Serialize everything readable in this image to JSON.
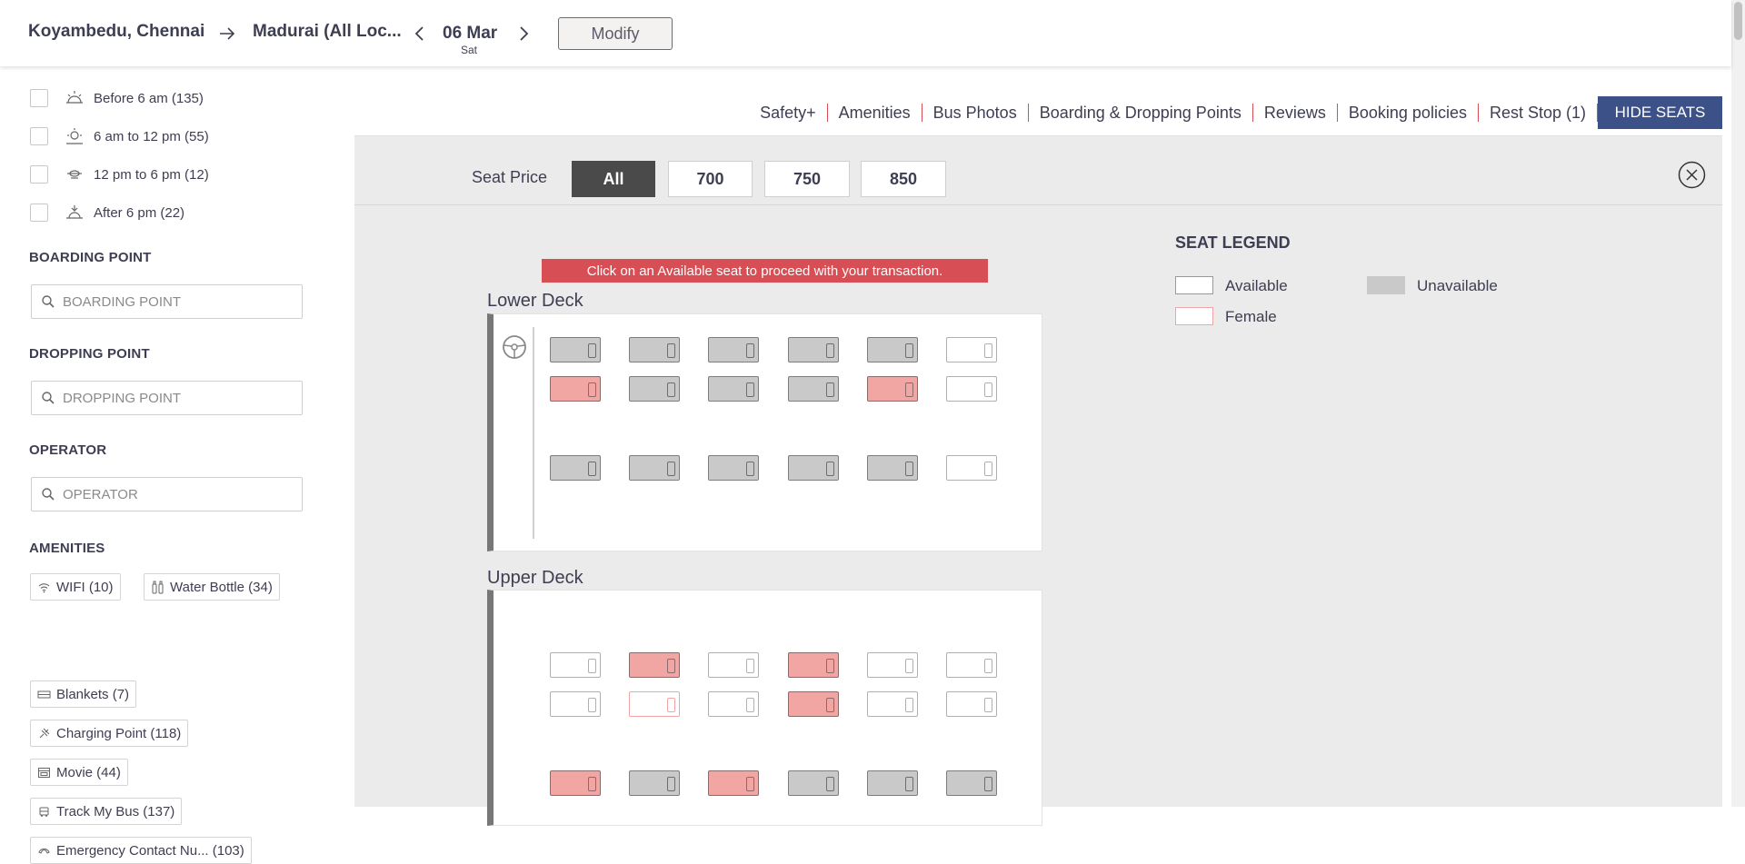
{
  "header": {
    "from": "Koyambedu, Chennai",
    "to": "Madurai (All Loc...",
    "date": "06 Mar",
    "weekday": "Sat",
    "modify_label": "Modify"
  },
  "filters": {
    "departure_times": [
      {
        "label": "Before 6 am (135)",
        "icon": "sunrise-icon"
      },
      {
        "label": "6 am to 12 pm (55)",
        "icon": "sun-icon"
      },
      {
        "label": "12 pm to 6 pm (12)",
        "icon": "sun-cloud-icon"
      },
      {
        "label": "After 6 pm (22)",
        "icon": "sunset-icon"
      }
    ],
    "boarding_title": "BOARDING POINT",
    "boarding_placeholder": "BOARDING POINT",
    "dropping_title": "DROPPING POINT",
    "dropping_placeholder": "DROPPING POINT",
    "operator_title": "OPERATOR",
    "operator_placeholder": "OPERATOR",
    "amenities_title": "AMENITIES",
    "amenities": [
      {
        "label": "WIFI (10)",
        "icon": "wifi-icon"
      },
      {
        "label": "Water Bottle (34)",
        "icon": "water-bottle-icon"
      },
      {
        "label": "Blankets (7)",
        "icon": "blanket-icon"
      },
      {
        "label": "Charging Point (118)",
        "icon": "charging-icon"
      },
      {
        "label": "Movie (44)",
        "icon": "movie-icon"
      },
      {
        "label": "Track My Bus (137)",
        "icon": "track-bus-icon"
      },
      {
        "label": "Emergency Contact Nu... (103)",
        "icon": "phone-icon"
      }
    ]
  },
  "tabs": [
    "Safety+",
    "Amenities",
    "Bus Photos",
    "Boarding & Dropping Points",
    "Reviews",
    "Booking policies",
    "Rest Stop (1)"
  ],
  "hide_seats_label": "HIDE SEATS",
  "seat_price": {
    "label": "Seat Price",
    "options": [
      "All",
      "700",
      "750",
      "850"
    ],
    "selected": "All"
  },
  "notice": "Click on an Available seat to proceed with your transaction.",
  "lower_deck": {
    "title": "Lower Deck",
    "rows": [
      [
        "unavailable",
        "unavailable",
        "unavailable",
        "unavailable",
        "unavailable",
        "available"
      ],
      [
        "booked-female",
        "unavailable",
        "unavailable",
        "unavailable",
        "booked-female",
        "available"
      ],
      [
        "unavailable",
        "unavailable",
        "unavailable",
        "unavailable",
        "unavailable",
        "available"
      ]
    ]
  },
  "upper_deck": {
    "title": "Upper Deck",
    "rows": [
      [
        "available",
        "booked-female",
        "available",
        "booked-female",
        "available",
        "available"
      ],
      [
        "available",
        "female",
        "available",
        "booked-female",
        "available",
        "available"
      ],
      [
        "booked-female",
        "unavailable",
        "booked-female",
        "unavailable",
        "unavailable",
        "unavailable"
      ]
    ]
  },
  "legend": {
    "title": "SEAT LEGEND",
    "available": "Available",
    "unavailable": "Unavailable",
    "female": "Female"
  },
  "colors": {
    "accent_red": "#d84e55",
    "hide_seats_blue": "#3c5188",
    "unavailable_grey": "#c9c9c9",
    "booked_female_pink": "#f2a6a4"
  }
}
